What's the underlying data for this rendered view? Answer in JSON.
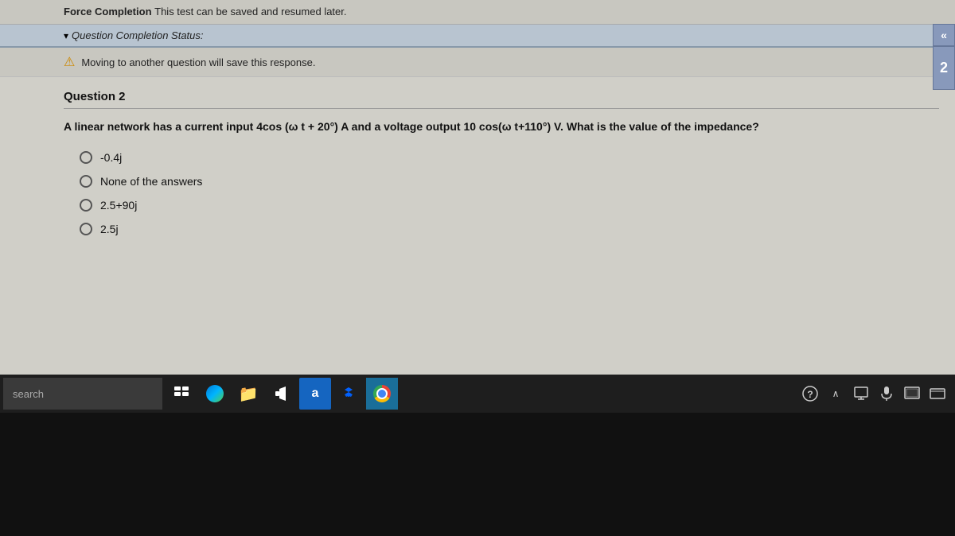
{
  "top_bar": {
    "force_completion_label": "Force Completion",
    "force_completion_text": "This test can be saved and resumed later."
  },
  "status_bar": {
    "collapse_arrow": "▾",
    "label": "Question Completion Status:"
  },
  "collapse_buttons": {
    "left_arrow": "«",
    "right_number": "2"
  },
  "warning": {
    "icon": "⚠",
    "text": "Moving to another question will save this response."
  },
  "question": {
    "number": "Question 2",
    "text": "A linear network has a current input 4cos (ω t + 20°) A and a voltage output 10 cos(ω t+110°) V. What is the value of the impedance?",
    "options": [
      {
        "id": "opt1",
        "text": "-0.4j"
      },
      {
        "id": "opt2",
        "text": "None of the answers"
      },
      {
        "id": "opt3",
        "text": "2.5+90j"
      },
      {
        "id": "opt4",
        "text": "2.5j"
      }
    ]
  },
  "taskbar": {
    "search_text": "search",
    "icons": [
      {
        "id": "task-view",
        "label": "Task View",
        "symbol": "⊞"
      },
      {
        "id": "edge",
        "label": "Microsoft Edge",
        "symbol": "edge"
      },
      {
        "id": "file-explorer",
        "label": "File Explorer",
        "symbol": "📁"
      },
      {
        "id": "audio",
        "label": "Audio",
        "symbol": "🔊"
      },
      {
        "id": "text-a",
        "label": "Text Input",
        "symbol": "a"
      },
      {
        "id": "dropbox",
        "label": "Dropbox",
        "symbol": "❖"
      },
      {
        "id": "chrome",
        "label": "Google Chrome",
        "symbol": "chrome"
      }
    ],
    "tray_icons": [
      {
        "id": "help",
        "label": "Help",
        "symbol": "?"
      },
      {
        "id": "caret-up",
        "label": "Show hidden icons",
        "symbol": "∧"
      },
      {
        "id": "display",
        "label": "Display",
        "symbol": "☐"
      },
      {
        "id": "mic",
        "label": "Microphone",
        "symbol": "🎤"
      },
      {
        "id": "screenshot",
        "label": "Screenshot",
        "symbol": "⬛"
      },
      {
        "id": "window-full",
        "label": "Window",
        "symbol": "▬"
      }
    ]
  }
}
